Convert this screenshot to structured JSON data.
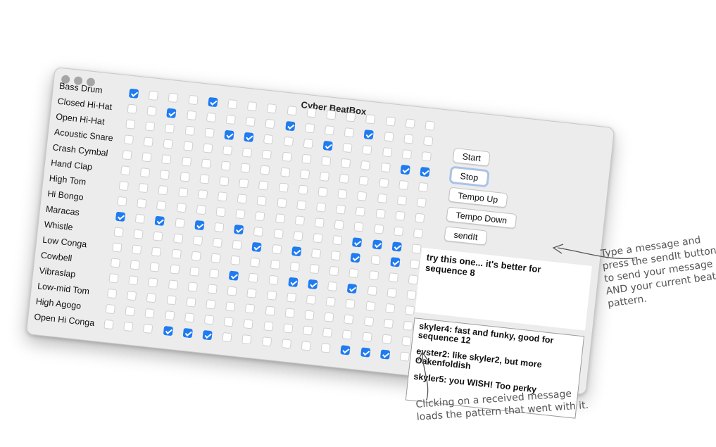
{
  "window": {
    "title": "Cyber BeatBox"
  },
  "instruments": [
    "Bass Drum",
    "Closed Hi-Hat",
    "Open Hi-Hat",
    "Acoustic Snare",
    "Crash Cymbal",
    "Hand Clap",
    "High Tom",
    "Hi Bongo",
    "Maracas",
    "Whistle",
    "Low Conga",
    "Cowbell",
    "Vibraslap",
    "Low-mid Tom",
    "High Agogo",
    "Open Hi Conga"
  ],
  "pattern": [
    [
      1,
      0,
      0,
      0,
      1,
      0,
      0,
      0,
      0,
      0,
      0,
      0,
      0,
      0,
      0,
      0
    ],
    [
      0,
      0,
      1,
      0,
      0,
      0,
      0,
      0,
      1,
      0,
      0,
      0,
      1,
      0,
      0,
      0
    ],
    [
      0,
      0,
      0,
      0,
      0,
      1,
      1,
      0,
      0,
      0,
      1,
      0,
      0,
      0,
      0,
      0
    ],
    [
      0,
      0,
      0,
      0,
      0,
      0,
      0,
      0,
      0,
      0,
      0,
      0,
      0,
      0,
      1,
      1
    ],
    [
      0,
      0,
      0,
      0,
      0,
      0,
      0,
      0,
      0,
      0,
      0,
      0,
      0,
      0,
      0,
      0
    ],
    [
      0,
      0,
      0,
      0,
      0,
      0,
      0,
      0,
      0,
      0,
      0,
      0,
      0,
      0,
      0,
      0
    ],
    [
      0,
      0,
      0,
      0,
      0,
      0,
      0,
      0,
      0,
      0,
      0,
      0,
      0,
      0,
      0,
      0
    ],
    [
      0,
      0,
      0,
      0,
      0,
      0,
      0,
      0,
      0,
      0,
      0,
      0,
      0,
      0,
      0,
      0
    ],
    [
      1,
      0,
      1,
      0,
      1,
      0,
      1,
      0,
      0,
      0,
      0,
      0,
      1,
      1,
      1,
      0
    ],
    [
      0,
      0,
      0,
      0,
      0,
      0,
      0,
      1,
      0,
      1,
      0,
      0,
      1,
      0,
      1,
      0
    ],
    [
      0,
      0,
      0,
      0,
      0,
      0,
      0,
      0,
      0,
      0,
      0,
      0,
      0,
      0,
      0,
      0
    ],
    [
      0,
      0,
      0,
      0,
      0,
      0,
      1,
      0,
      0,
      1,
      1,
      0,
      1,
      0,
      0,
      0
    ],
    [
      0,
      0,
      0,
      0,
      0,
      0,
      0,
      0,
      0,
      0,
      0,
      0,
      0,
      0,
      0,
      0
    ],
    [
      0,
      0,
      0,
      0,
      0,
      0,
      0,
      0,
      0,
      0,
      0,
      0,
      0,
      0,
      0,
      0
    ],
    [
      0,
      0,
      0,
      0,
      0,
      0,
      0,
      0,
      0,
      0,
      0,
      0,
      0,
      0,
      0,
      0
    ],
    [
      0,
      0,
      0,
      1,
      1,
      1,
      0,
      0,
      0,
      0,
      0,
      0,
      1,
      1,
      1,
      0
    ]
  ],
  "buttons": {
    "start": "Start",
    "stop": "Stop",
    "tempo_up": "Tempo Up",
    "tempo_down": "Tempo Down",
    "send": "sendIt"
  },
  "message_input": {
    "value": "try this one... it's better for sequence 8"
  },
  "incoming_messages": [
    "skyler4: fast and funky, good for sequence 12",
    "evster2: like skyler2, but more Oakenfoldish",
    "skyler5: you WISH! Too perky"
  ],
  "annotations": {
    "send_note": "Type a message and press the sendIt button to send your message AND your current beat pattern.",
    "receive_note": "Clicking on a received message loads the pattern that went with it."
  },
  "colors": {
    "checked": "#1f7bf0",
    "window_bg": "#ececec"
  }
}
